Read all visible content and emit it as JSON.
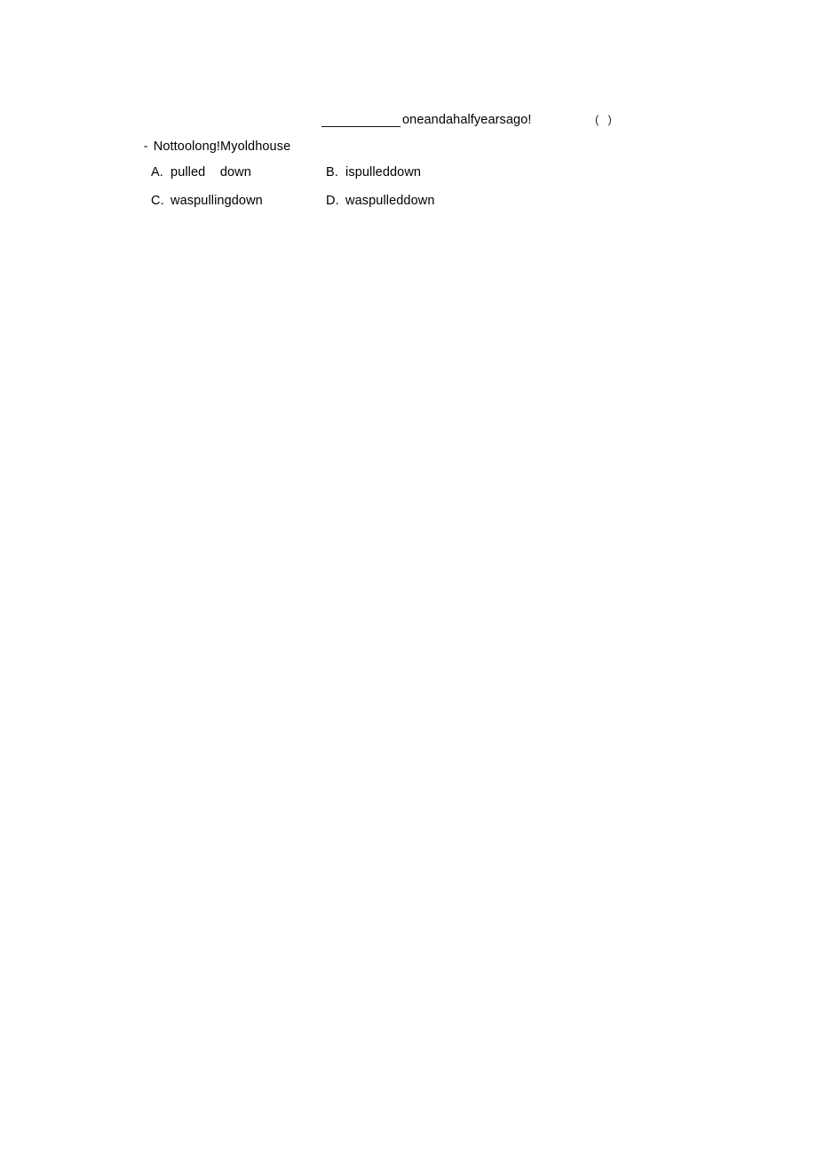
{
  "document": {
    "background_color": "#ffffff",
    "text_color": "#000000"
  },
  "question": {
    "dash_marker": "-",
    "stem_before_blank": "Nottoolong!Myoldhouse",
    "blank_placeholder": "",
    "stem_after_blank": "oneandahalfyearsago!",
    "answer_bracket": "(  )"
  },
  "options": [
    {
      "letter": "A.",
      "text": "pulled    down"
    },
    {
      "letter": "B.",
      "text": "ispulleddown"
    },
    {
      "letter": "C.",
      "text": "waspullingdown"
    },
    {
      "letter": "D.",
      "text": "waspulleddown"
    }
  ]
}
